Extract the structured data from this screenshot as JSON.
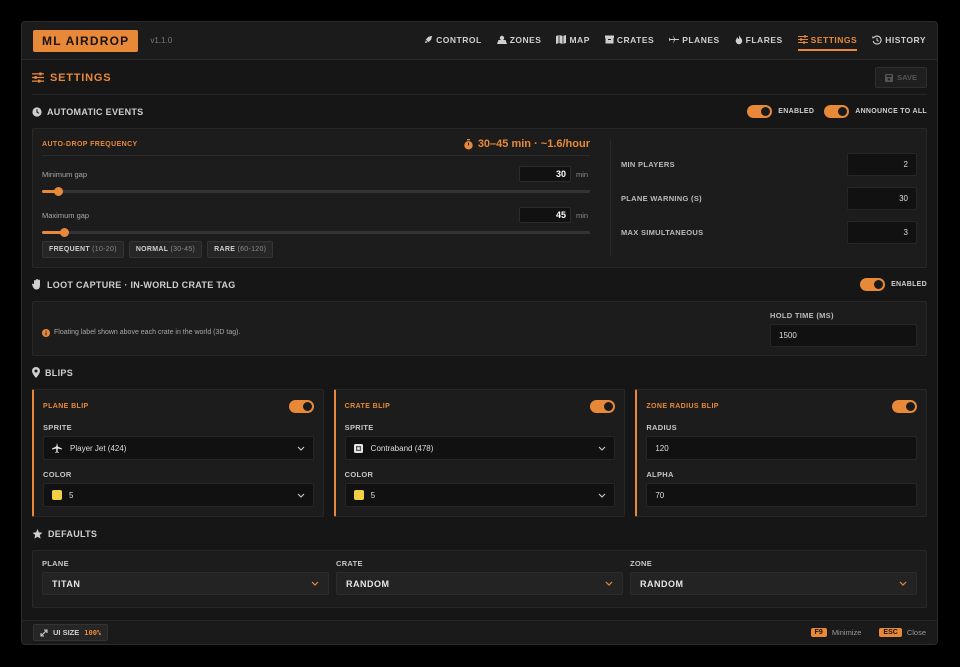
{
  "colors": {
    "accent": "#e8893a",
    "background": "#161616",
    "panel": "#1c1c1c",
    "swatch_yellow": "#f2d046"
  },
  "header": {
    "brand": "ML AIRDROP",
    "version": "v1.1.0",
    "nav": [
      {
        "label": "CONTROL",
        "icon": "rocket-icon"
      },
      {
        "label": "ZONES",
        "icon": "map-zones-icon"
      },
      {
        "label": "MAP",
        "icon": "map-icon"
      },
      {
        "label": "CRATES",
        "icon": "crate-icon"
      },
      {
        "label": "PLANES",
        "icon": "plane-icon"
      },
      {
        "label": "FLARES",
        "icon": "flame-icon"
      },
      {
        "label": "SETTINGS",
        "icon": "sliders-icon",
        "active": true
      },
      {
        "label": "HISTORY",
        "icon": "history-icon"
      }
    ]
  },
  "page": {
    "title": "SETTINGS",
    "save_label": "SAVE"
  },
  "automatic_events": {
    "title": "AUTOMATIC EVENTS",
    "toggle_enabled_label": "ENABLED",
    "toggle_announce_label": "ANNOUNCE TO ALL",
    "frequency": {
      "title": "AUTO-DROP FREQUENCY",
      "summary": "30–45 min · ~1.6/hour",
      "min_gap_label": "Minimum gap",
      "min_gap_value": "30",
      "max_gap_label": "Maximum gap",
      "max_gap_value": "45",
      "unit": "min",
      "min_gap_slider_fraction": 0.03,
      "max_gap_slider_fraction": 0.04,
      "presets": [
        {
          "name": "FREQUENT",
          "range": "(10-20)"
        },
        {
          "name": "NORMAL",
          "range": "(30-45)"
        },
        {
          "name": "RARE",
          "range": "(60-120)"
        }
      ]
    },
    "limits": [
      {
        "label": "MIN PLAYERS",
        "value": "2"
      },
      {
        "label": "PLANE WARNING (S)",
        "value": "30"
      },
      {
        "label": "MAX SIMULTANEOUS",
        "value": "3"
      }
    ]
  },
  "loot_capture": {
    "title": "LOOT CAPTURE · IN-WORLD CRATE TAG",
    "toggle_label": "ENABLED",
    "info": "Floating label shown above each crate in the world (3D tag).",
    "hold_time_label": "HOLD TIME (MS)",
    "hold_time_value": "1500"
  },
  "blips": {
    "title": "BLIPS",
    "plane": {
      "title": "PLANE BLIP",
      "sprite_label": "SPRITE",
      "sprite_value": "Player Jet (424)",
      "color_label": "COLOR",
      "color_value": "5"
    },
    "crate": {
      "title": "CRATE BLIP",
      "sprite_label": "SPRITE",
      "sprite_value": "Contraband (478)",
      "color_label": "COLOR",
      "color_value": "5"
    },
    "zone": {
      "title": "ZONE RADIUS BLIP",
      "radius_label": "RADIUS",
      "radius_value": "120",
      "alpha_label": "ALPHA",
      "alpha_value": "70"
    }
  },
  "defaults": {
    "title": "DEFAULTS",
    "fields": [
      {
        "label": "PLANE",
        "value": "TITAN"
      },
      {
        "label": "CRATE",
        "value": "RANDOM"
      },
      {
        "label": "ZONE",
        "value": "RANDOM"
      }
    ]
  },
  "footer": {
    "ui_size_label": "UI SIZE",
    "ui_size_value": "100%",
    "hotkeys": [
      {
        "key": "F9",
        "label": "Minimize"
      },
      {
        "key": "ESC",
        "label": "Close"
      }
    ]
  }
}
